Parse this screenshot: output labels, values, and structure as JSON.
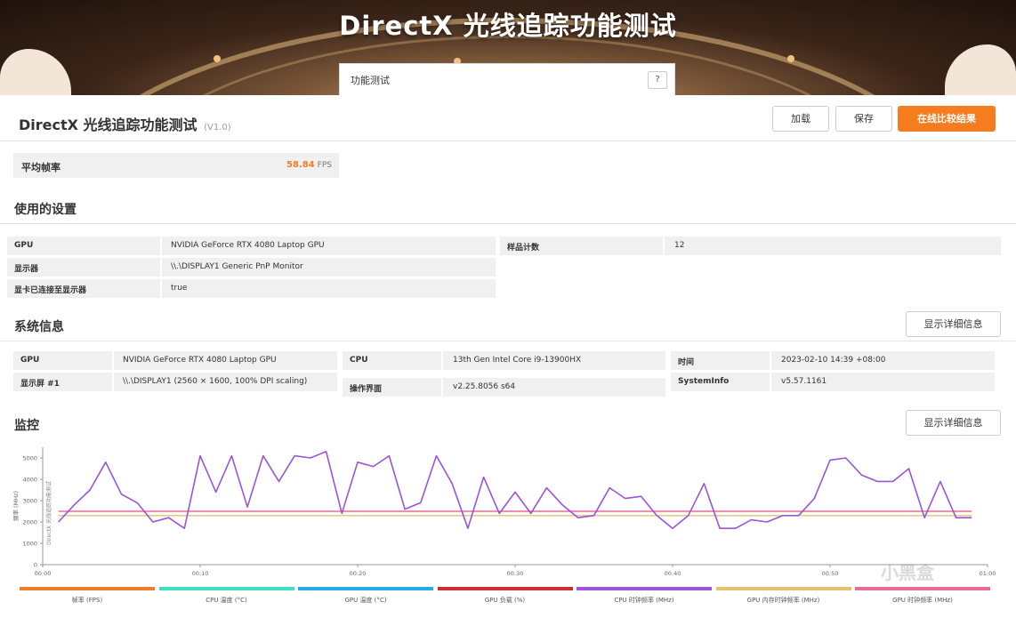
{
  "hero": {
    "title": "DirectX 光线追踪功能测试",
    "tab_label": "功能测试",
    "help": "?"
  },
  "header": {
    "title": "DirectX 光线追踪功能测试",
    "version": "(V1.0)"
  },
  "buttons": {
    "load": "加载",
    "save": "保存",
    "compare": "在线比较结果"
  },
  "fps": {
    "label": "平均帧率",
    "value": "58.84",
    "unit": "FPS"
  },
  "settings": {
    "title": "使用的设置",
    "rows": [
      {
        "key": "GPU",
        "value": "NVIDIA GeForce RTX 4080 Laptop GPU"
      },
      {
        "key": "显示器",
        "value": "\\\\.\\DISPLAY1 Generic PnP Monitor"
      },
      {
        "key": "显卡已连接至显示器",
        "value": "true"
      }
    ],
    "right": {
      "key": "样品计数",
      "value": "12"
    }
  },
  "sysinfo": {
    "title": "系统信息",
    "detail_button": "显示详细信息",
    "col1": [
      {
        "key": "GPU",
        "value": "NVIDIA GeForce RTX 4080 Laptop GPU"
      },
      {
        "key": "显示屏 #1",
        "value": "\\\\.\\DISPLAY1 (2560 × 1600, 100% DPI scaling)"
      }
    ],
    "col2": [
      {
        "key": "CPU",
        "value": "13th Gen Intel Core i9-13900HX"
      },
      {
        "key": "操作界面",
        "value": "v2.25.8056 s64"
      }
    ],
    "col3": [
      {
        "key": "时间",
        "value": "2023-02-10 14:39 +08:00"
      },
      {
        "key": "SystemInfo",
        "value": "v5.57.1161"
      }
    ]
  },
  "monitor": {
    "title": "监控",
    "detail_button": "显示详细信息"
  },
  "colors": {
    "accent": "#f57c1f",
    "cpu_clock": "#9b55d6",
    "gpu_mem_clock": "#e8c170",
    "gpu_clock": "#e86a9c"
  },
  "chart_data": {
    "type": "line",
    "ylabel": "频率 (MHz)",
    "ylabel2": "DirectX 光线追踪功能测试",
    "ylim": [
      0,
      5500
    ],
    "yticks": [
      0,
      1000,
      2000,
      3000,
      4000,
      5000
    ],
    "xticks": [
      "00:00",
      "00:10",
      "00:20",
      "00:30",
      "00:40",
      "00:50",
      "01:00"
    ],
    "xlim": [
      0,
      60
    ],
    "series": [
      {
        "name": "CPU 时钟频率 (MHz)",
        "color": "#9b55d6",
        "x": [
          1,
          2,
          3,
          4,
          5,
          6,
          7,
          8,
          9,
          10,
          11,
          12,
          13,
          14,
          15,
          16,
          17,
          18,
          19,
          20,
          21,
          22,
          23,
          24,
          25,
          26,
          27,
          28,
          29,
          30,
          31,
          32,
          33,
          34,
          35,
          36,
          37,
          38,
          39,
          40,
          41,
          42,
          43,
          44,
          45,
          46,
          47,
          48,
          49,
          50,
          51,
          52,
          53,
          54,
          55,
          56,
          57,
          58,
          59
        ],
        "values": [
          2000,
          2800,
          3500,
          4800,
          3300,
          2900,
          2000,
          2200,
          1700,
          5100,
          3400,
          5100,
          2700,
          5100,
          3900,
          5100,
          5000,
          5300,
          2400,
          4800,
          4600,
          5100,
          2600,
          2900,
          5100,
          3800,
          1700,
          4100,
          2400,
          3400,
          2400,
          3600,
          2800,
          2200,
          2300,
          3600,
          3100,
          3200,
          2300,
          1700,
          2300,
          3800,
          1700,
          1700,
          2100,
          2000,
          2300,
          2300,
          3100,
          4900,
          5000,
          4200,
          3900,
          3900,
          4500,
          2200,
          3900,
          2200,
          2200
        ]
      },
      {
        "name": "GPU 内存时钟频率 (MHz)",
        "color": "#e8c170",
        "x": [
          1,
          59
        ],
        "values": [
          2300,
          2300
        ]
      },
      {
        "name": "GPU 时钟频率 (MHz)",
        "color": "#e86a9c",
        "x": [
          1,
          59
        ],
        "values": [
          2500,
          2500
        ]
      }
    ],
    "legend": [
      {
        "label": "帧率 (FPS)",
        "color": "#f07c2a"
      },
      {
        "label": "CPU 温度 (°C)",
        "color": "#3ee0c0"
      },
      {
        "label": "GPU 温度 (°C)",
        "color": "#2aaae8"
      },
      {
        "label": "GPU 负载 (%)",
        "color": "#cc3030"
      },
      {
        "label": "CPU 时钟频率 (MHz)",
        "color": "#9b55d6"
      },
      {
        "label": "GPU 内存时钟频率 (MHz)",
        "color": "#e8c170"
      },
      {
        "label": "GPU 时钟频率 (MHz)",
        "color": "#e86a9c"
      }
    ]
  },
  "watermark": "小黑盒"
}
